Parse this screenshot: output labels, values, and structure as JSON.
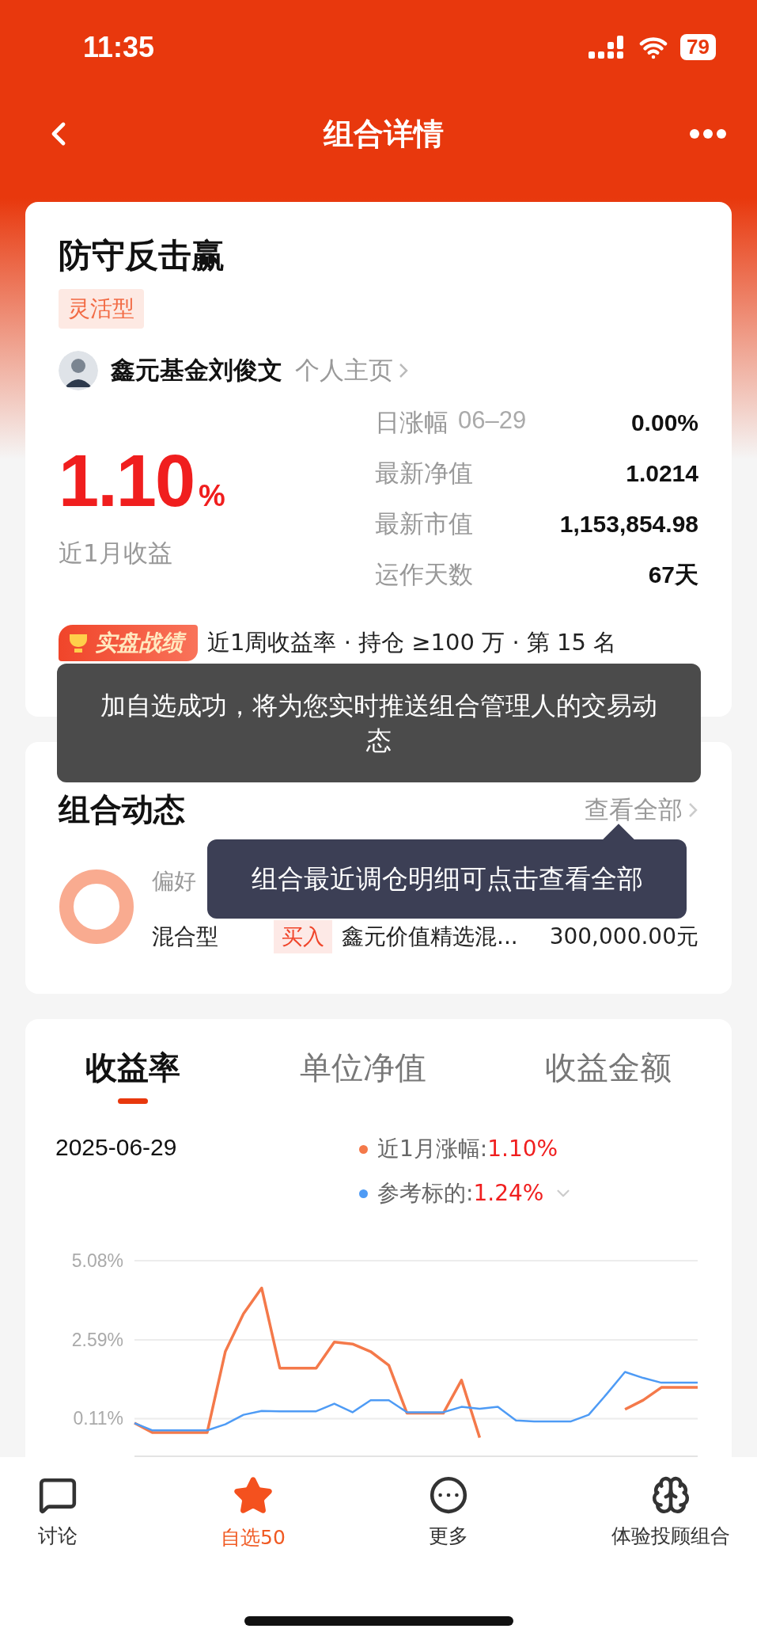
{
  "status_bar": {
    "time": "11:35",
    "battery": "79"
  },
  "nav": {
    "title": "组合详情"
  },
  "portfolio": {
    "name": "防守反击赢",
    "tag": "灵活型",
    "manager": "鑫元基金刘俊文",
    "profile_link": "个人主页",
    "return_value": "1.10",
    "return_unit": "%",
    "return_label": "近1月收益",
    "stats": [
      {
        "label": "日涨幅",
        "date": "06–29",
        "value": "0.00%"
      },
      {
        "label": "最新净值",
        "value": "1.0214"
      },
      {
        "label": "最新市值",
        "value": "1,153,854.98"
      },
      {
        "label": "运作天数",
        "value": "67天"
      }
    ],
    "ranking": {
      "badge": "实盘战绩",
      "text": "近1周收益率 · 持仓 ≥100 万 · 第 15 名"
    }
  },
  "toast": "加自选成功，将为您实时推送组合管理人的交易动态",
  "dynamics": {
    "title": "组合动态",
    "view_all": "查看全部",
    "preference_label": "偏好",
    "preference_value": "混合型",
    "trade": {
      "action": "买入",
      "fund": "鑫元价值精选混...",
      "amount": "300,000.00元"
    },
    "tooltip": "组合最近调仓明细可点击查看全部"
  },
  "performance": {
    "tabs": [
      {
        "label": "收益率",
        "selected": true
      },
      {
        "label": "单位净值",
        "selected": false
      },
      {
        "label": "收益金额",
        "selected": false
      }
    ],
    "date": "2025-06-29",
    "legend": [
      {
        "label": "近1月涨幅:",
        "value": "1.10%",
        "color": "#f4794a",
        "dropdown": false
      },
      {
        "label": "参考标的:",
        "value": "1.24%",
        "color": "#4e9bf5",
        "dropdown": true
      }
    ],
    "chart_data": {
      "type": "line",
      "grid": true,
      "ylim": [
        -1.1,
        5.08
      ],
      "yticks": [
        {
          "value": 5.08,
          "label": "5.08%"
        },
        {
          "value": 2.59,
          "label": "2.59%"
        },
        {
          "value": 0.11,
          "label": "0.11%"
        }
      ],
      "series": [
        {
          "color": "#f4794a",
          "values": [
            -0.03,
            -0.33,
            -0.33,
            -0.33,
            -0.33,
            2.22,
            3.41,
            4.22,
            1.7,
            1.7,
            1.7,
            2.52,
            2.46,
            2.22,
            1.79,
            0.28,
            0.28,
            0.28,
            1.32,
            -0.49,
            null,
            null,
            null,
            null,
            null,
            null,
            null,
            0.4,
            0.69,
            1.09,
            1.09,
            1.09
          ]
        },
        {
          "color": "#4e9bf5",
          "values": [
            -0.03,
            -0.26,
            -0.26,
            -0.26,
            -0.26,
            -0.07,
            0.23,
            0.35,
            0.34,
            0.34,
            0.34,
            0.58,
            0.31,
            0.69,
            0.69,
            0.31,
            0.31,
            0.31,
            0.48,
            0.42,
            0.48,
            0.05,
            0.02,
            0.02,
            0.02,
            0.23,
            0.89,
            1.58,
            1.39,
            1.24,
            1.24,
            1.24
          ]
        }
      ],
      "data_labels": false
    }
  },
  "bottom_nav": [
    {
      "label": "讨论",
      "kind": "chat",
      "selected": false
    },
    {
      "label": "自选50",
      "kind": "star",
      "selected": true
    },
    {
      "label": "更多",
      "kind": "more",
      "selected": false
    },
    {
      "label": "体验投顾组合",
      "kind": "advisor",
      "selected": false
    }
  ]
}
